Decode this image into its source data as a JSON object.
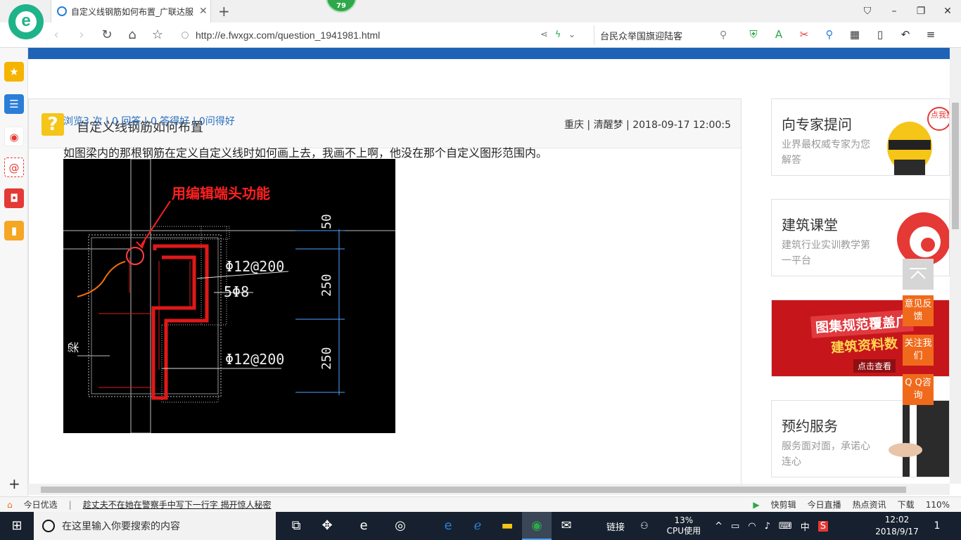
{
  "browser": {
    "tab_title": "自定义线钢筋如何布置_广联达服",
    "badge": "79",
    "url": "http://e.fwxgx.com/question_1941981.html",
    "search_text": "台民众举国旗迎陆客"
  },
  "question": {
    "title": "自定义线钢筋如何布置",
    "meta": "重庆 | 清醒梦 | 2018-09-17 12:00:5",
    "stats": "浏览3 次 | 0 回答 | 0 答得好 | 0问得好",
    "body": "如图梁内的那根钢筋在定义自定义线时如何画上去，我画不上啊，他没在那个自定义图形范围内。",
    "image_annotation": "用编辑端头功能",
    "image_labels": [
      "Φ12@200",
      "5Φ8",
      "Φ12@200",
      "50",
      "250",
      "250",
      "梁"
    ]
  },
  "sidebar_cards": [
    {
      "title": "向专家提问",
      "sub": "业界最权威专家为您解答",
      "badge": "点我提问"
    },
    {
      "title": "建筑课堂",
      "sub": "建筑行业实训教学第一平台"
    },
    {
      "title": "图集规范覆盖广",
      "sub": "建筑资料数",
      "cta": "点击查看"
    },
    {
      "title": "预约服务",
      "sub": "服务面对面，承诺心连心"
    }
  ],
  "float_buttons": [
    "意见反馈",
    "关注我们",
    "Q Q咨询"
  ],
  "statusbar": {
    "left": [
      "今日优选",
      "趁丈夫不在她在警察手中写下一行字 揭开惊人秘密"
    ],
    "right": [
      "快剪辑",
      "今日直播",
      "热点资讯",
      "下载",
      "110%"
    ]
  },
  "taskbar": {
    "search_placeholder": "在这里输入你要搜索的内容",
    "tray": [
      "链接",
      "13%",
      "CPU使用",
      "中"
    ],
    "time": "12:02",
    "date": "2018/9/17",
    "notify_count": "1"
  },
  "colors": {
    "accent": "#1f63b6",
    "orange": "#f06a1c",
    "red": "#c6161b"
  }
}
